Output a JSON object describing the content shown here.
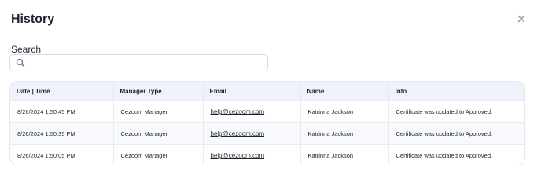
{
  "dialog": {
    "title": "History",
    "close_icon": "close-icon"
  },
  "search": {
    "label": "Search",
    "placeholder": "",
    "value": "",
    "icon": "search-icon"
  },
  "table": {
    "headers": [
      "Date | Time",
      "Manager Type",
      "Email",
      "Name",
      "Info"
    ],
    "rows": [
      [
        "8/26/2024 1:50:45 PM",
        "Cezoom Manager",
        "help@cezoom.com",
        "Katrinna Jackson",
        "Certificate was updated to Approved."
      ],
      [
        "8/26/2024 1:50:35 PM",
        "Cezoom Manager",
        "help@cezoom.com",
        "Katrinna Jackson",
        "Certificate was updated to Approved."
      ],
      [
        "8/26/2024 1:50:05 PM",
        "Cezoom Manager",
        "help@cezoom.com",
        "Katrinna Jackson",
        "Certificate was updated to Approved."
      ]
    ]
  },
  "colors": {
    "header_bg": "#eef3fb",
    "border": "#e4e8ef"
  }
}
